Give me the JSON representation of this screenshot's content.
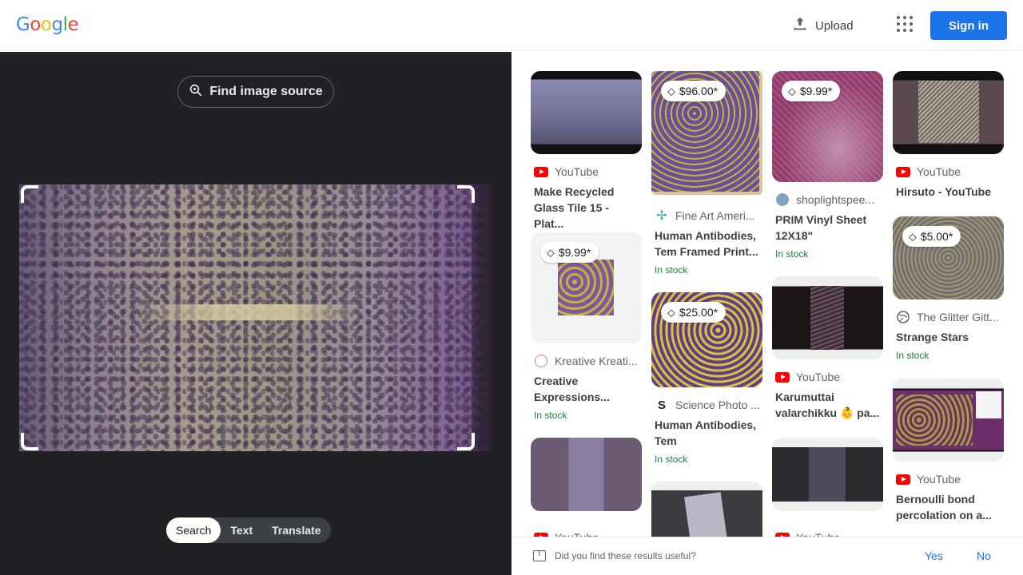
{
  "header": {
    "logo_letters": [
      "G",
      "o",
      "o",
      "g",
      "l",
      "e"
    ],
    "logo_colors": [
      "#4285F4",
      "#EA4335",
      "#FBBC05",
      "#4285F4",
      "#34A853",
      "#EA4335"
    ],
    "upload_label": "Upload",
    "signin_label": "Sign in"
  },
  "lens": {
    "find_source_label": "Find image source",
    "modes": [
      "Search",
      "Text",
      "Translate"
    ],
    "active_mode": "Search"
  },
  "results": [
    {
      "source": "YouTube",
      "favicon": "youtube-icon",
      "title": "Make Recycled Glass Tile 15 - Plat...",
      "price": "",
      "stock": "",
      "thumb_colors": [
        "#8b8ab0",
        "#55526e"
      ]
    },
    {
      "source": "Fine Art Ameri...",
      "favicon": "fineart-icon",
      "title": "Human Antibodies, Tem Framed Print...",
      "price": "$96.00*",
      "stock": "In stock",
      "thumb_colors": [
        "#6a4f9a",
        "#c9b23a"
      ]
    },
    {
      "source": "shoplightspee...",
      "favicon": "shoplightspeed-icon",
      "title": "PRIM Vinyl Sheet 12X18\"",
      "price": "$9.99*",
      "stock": "In stock",
      "thumb_colors": [
        "#8e3a6b",
        "#b56b93"
      ]
    },
    {
      "source": "YouTube",
      "favicon": "youtube-icon",
      "title": "Hirsuto - YouTube",
      "price": "",
      "stock": "",
      "thumb_colors": [
        "#5a4a50",
        "#b8ae9f"
      ]
    },
    {
      "source": "Kreative Kreati...",
      "favicon": "kreative-icon",
      "title": "Creative Expressions...",
      "price": "$9.99*",
      "stock": "In stock",
      "thumb_colors": [
        "#7d5aa0",
        "#d4b53a"
      ]
    },
    {
      "source": "Science Photo ...",
      "favicon": "sciencephoto-icon",
      "title": "Human Antibodies, Tem",
      "price": "$25.00*",
      "stock": "In stock",
      "thumb_colors": [
        "#5d3f8f",
        "#e0c230"
      ]
    },
    {
      "source": "The Glitter Gitt...",
      "favicon": "globe-icon",
      "title": "Strange Stars",
      "price": "$5.00*",
      "stock": "In stock",
      "thumb_colors": [
        "#6e6c7e",
        "#a69a5a"
      ]
    },
    {
      "source": "YouTube",
      "favicon": "youtube-icon",
      "title": "Karumuttai valarchikku 👶 pa...",
      "price": "",
      "stock": "",
      "thumb_colors": [
        "#1b1419",
        "#3e2e3a"
      ]
    },
    {
      "source": "YouTube",
      "favicon": "youtube-icon",
      "title": "Bernoulli bond percolation on a...",
      "price": "",
      "stock": "",
      "thumb_colors": [
        "#6b2e6a",
        "#a59a40"
      ]
    },
    {
      "source": "YouTube",
      "favicon": "youtube-icon",
      "title": "",
      "price": "",
      "stock": "",
      "thumb_colors": [
        "#6a5a72",
        "#8a7fa0"
      ]
    },
    {
      "source": "",
      "favicon": "",
      "title": "",
      "price": "",
      "stock": "",
      "thumb_colors": [
        "#3a3a3f",
        "#9c9ca8"
      ]
    },
    {
      "source": "YouTube",
      "favicon": "youtube-icon",
      "title": "",
      "price": "",
      "stock": "",
      "thumb_colors": [
        "#2c2b30",
        "#4d4a5a"
      ]
    }
  ],
  "feedback": {
    "question": "Did you find these results useful?",
    "yes_label": "Yes",
    "no_label": "No"
  }
}
